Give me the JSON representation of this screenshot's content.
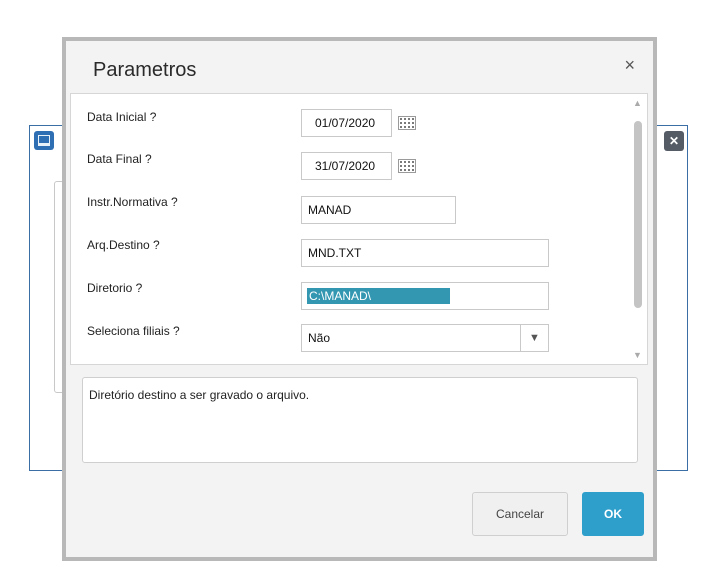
{
  "dialog": {
    "title": "Parametros",
    "close_glyph": "×"
  },
  "params": [
    {
      "label": "Data Inicial ?",
      "value": "01/07/2020",
      "type": "date"
    },
    {
      "label": "Data Final ?",
      "value": "31/07/2020",
      "type": "date"
    },
    {
      "label": "Instr.Normativa ?",
      "value": "MANAD",
      "type": "text"
    },
    {
      "label": "Arq.Destino ?",
      "value": "MND.TXT",
      "type": "text"
    },
    {
      "label": "Diretorio ?",
      "value": "C:\\MANAD\\",
      "type": "text",
      "selected": true
    },
    {
      "label": "Seleciona filiais ?",
      "value": "Não",
      "type": "select"
    }
  ],
  "help_text": "Diretório destino a ser gravado o arquivo.",
  "buttons": {
    "cancel": "Cancelar",
    "ok": "OK"
  },
  "icons": {
    "calendar": "calendar-icon",
    "dropdown": "chevron-down-icon",
    "close": "close-icon"
  },
  "colors": {
    "accent": "#2e9ecb",
    "selection": "#3497b2"
  }
}
